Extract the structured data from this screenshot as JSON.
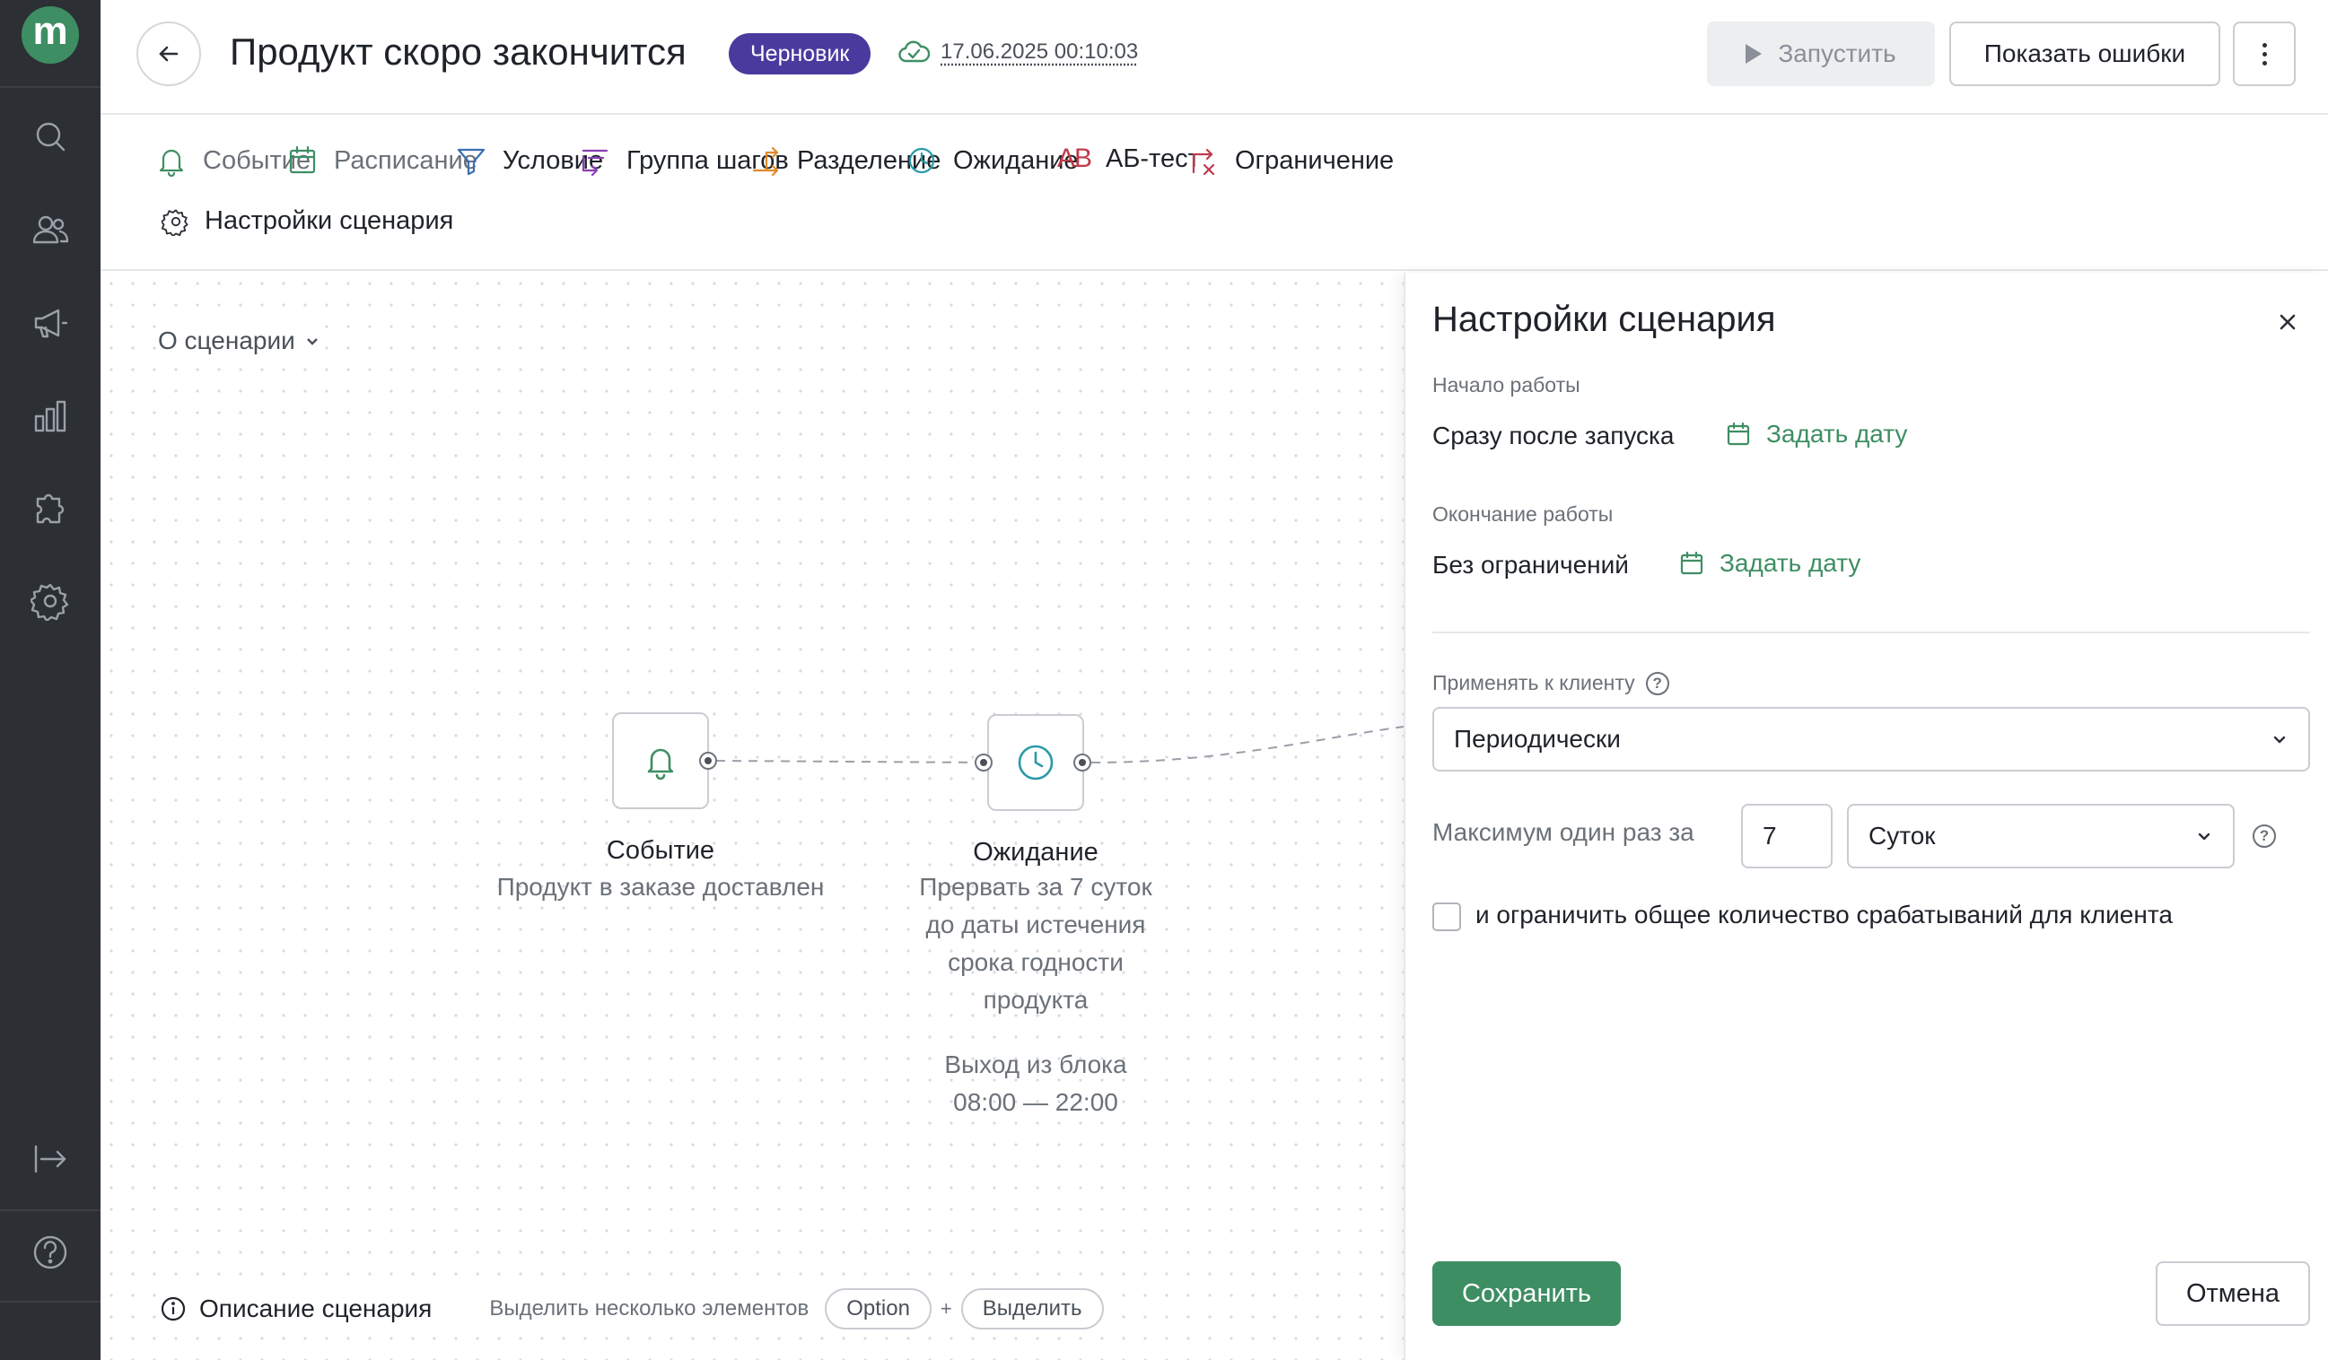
{
  "app": {
    "logo_letter": "m",
    "brand_color": "#3e8e63"
  },
  "rail": {
    "items": [
      {
        "icon": "search-icon"
      },
      {
        "icon": "users-icon"
      },
      {
        "icon": "megaphone-icon"
      },
      {
        "icon": "analytics-icon"
      },
      {
        "icon": "puzzle-icon"
      },
      {
        "icon": "gear-icon"
      }
    ],
    "bottom": [
      {
        "icon": "collapse-icon"
      },
      {
        "icon": "help-icon"
      }
    ]
  },
  "header": {
    "title": "Продукт скоро закончится",
    "status_badge": "Черновик",
    "saved_at": "17.06.2025 00:10:03",
    "run_label": "Запустить",
    "errors_label": "Показать ошибки"
  },
  "toolbar": {
    "items": [
      {
        "label": "Событие",
        "icon": "bell-icon",
        "color": "#3e8e63"
      },
      {
        "label": "Расписание",
        "icon": "calendar-icon",
        "color": "#3e8e63"
      },
      {
        "label": "Условие",
        "icon": "filter-icon",
        "color": "#3a6fb5"
      },
      {
        "label": "Группа шагов",
        "icon": "step-group-icon",
        "color": "#8a3fb5"
      },
      {
        "label": "Разделение",
        "icon": "split-icon",
        "color": "#e08a2a"
      },
      {
        "label": "Ожидание",
        "icon": "clock-icon",
        "color": "#2a9aa8"
      },
      {
        "label": "АБ-тест",
        "icon": "ab-test-icon",
        "icon_text": "AB",
        "color": "#c0394a"
      },
      {
        "label": "Ограничение",
        "icon": "limit-icon",
        "color": "#c0394a"
      }
    ],
    "settings_label": "Настройки сценария"
  },
  "canvas": {
    "about_label": "О сценарии",
    "nodes": {
      "event": {
        "title": "Событие",
        "desc": "Продукт в заказе доставлен",
        "icon": "bell-icon"
      },
      "wait": {
        "title": "Ожидание",
        "desc_lines": [
          "Прервать за 7 суток",
          "до даты истечения",
          "срока годности",
          "продукта"
        ],
        "exit_lines": [
          "Выход из блока",
          "08:00 — 22:00"
        ],
        "icon": "clock-icon"
      }
    },
    "footer": {
      "description_label": "Описание сценария",
      "hint": "Выделить несколько элементов",
      "key1": "Option",
      "plus": "+",
      "key2": "Выделить"
    }
  },
  "panel": {
    "title": "Настройки сценария",
    "start": {
      "label": "Начало работы",
      "value": "Сразу после запуска",
      "link": "Задать дату"
    },
    "end": {
      "label": "Окончание работы",
      "value": "Без ограничений",
      "link": "Задать дату"
    },
    "apply": {
      "label": "Применять к клиенту",
      "value": "Периодически"
    },
    "max": {
      "label": "Максимум один раз за",
      "number": "7",
      "unit": "Суток"
    },
    "limit_checkbox": {
      "label": "и ограничить общее количество срабатываний для клиента",
      "checked": false
    },
    "save_label": "Сохранить",
    "cancel_label": "Отмена"
  }
}
